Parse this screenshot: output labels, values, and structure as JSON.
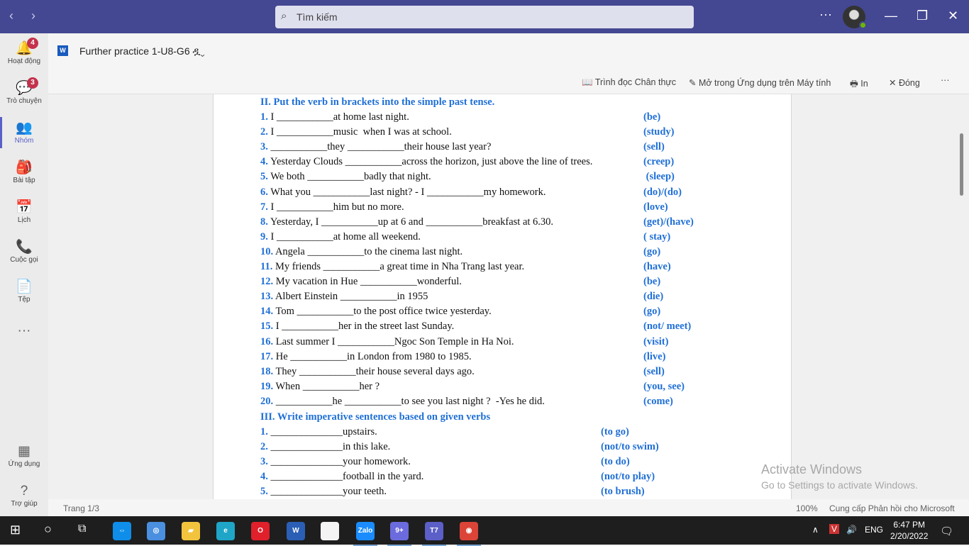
{
  "titlebar": {
    "search_placeholder": "Tìm kiếm",
    "more": "···"
  },
  "rail": [
    {
      "label": "Hoạt động",
      "icon": "bell-icon",
      "glyph": "🔔",
      "badge": "4"
    },
    {
      "label": "Trò chuyện",
      "icon": "chat-icon",
      "glyph": "💬",
      "badge": "3"
    },
    {
      "label": "Nhóm",
      "icon": "teams-icon",
      "glyph": "👥",
      "active": true
    },
    {
      "label": "Bài tập",
      "icon": "backpack-icon",
      "glyph": "🎒"
    },
    {
      "label": "Lịch",
      "icon": "calendar-icon",
      "glyph": "📅"
    },
    {
      "label": "Cuộc gọi",
      "icon": "phone-icon",
      "glyph": "📞"
    },
    {
      "label": "Tệp",
      "icon": "file-icon",
      "glyph": "📄"
    },
    {
      "label": "",
      "icon": "more-icon",
      "glyph": "···"
    },
    {
      "label": "Ứng dụng",
      "icon": "apps-icon",
      "glyph": "▦"
    },
    {
      "label": "Trợ giúp",
      "icon": "help-icon",
      "glyph": "?"
    }
  ],
  "header": {
    "doc_title": "Further practice 1-U8-G6"
  },
  "toolbar": {
    "immersive": "Trình đọc Chân thực",
    "open_desktop": "Mở trong Ứng dụng trên Máy tính",
    "print": "In",
    "close": "Đóng",
    "more": "···"
  },
  "document": {
    "section2": {
      "title": "II. Put the verb in brackets into the simple past tense.",
      "items": [
        {
          "n": "1.",
          "t": " I ___________at home last night.",
          "h": "(be)"
        },
        {
          "n": "2.",
          "t": " I ___________music  when I was at school.",
          "h": "(study)"
        },
        {
          "n": "3.",
          "t": " ___________they ___________their house last year?",
          "h": "(sell)"
        },
        {
          "n": "4.",
          "t": " Yesterday Clouds ___________across the horizon, just above the line of trees.",
          "h": "(creep)"
        },
        {
          "n": "5.",
          "t": " We both ___________badly that night.",
          "h": " (sleep)"
        },
        {
          "n": "6.",
          "t": " What you ___________last night? - I ___________my homework.",
          "h": "(do)/(do)"
        },
        {
          "n": "7.",
          "t": " I ___________him but no more.",
          "h": "(love)"
        },
        {
          "n": "8.",
          "t": " Yesterday, I ___________up at 6 and ___________breakfast at 6.30.",
          "h": "(get)/(have)"
        },
        {
          "n": "9.",
          "t": " I ___________at home all weekend.",
          "h": "( stay)"
        },
        {
          "n": "10.",
          "t": " Angela ___________to the cinema last night.",
          "h": "(go)"
        },
        {
          "n": "11.",
          "t": " My friends ___________a great time in Nha Trang last year.",
          "h": "(have)"
        },
        {
          "n": "12.",
          "t": " My vacation in Hue ___________wonderful.",
          "h": "(be)"
        },
        {
          "n": "13.",
          "t": " Albert Einstein ___________in 1955",
          "h": "(die)"
        },
        {
          "n": "14.",
          "t": " Tom ___________to the post office twice yesterday.",
          "h": "(go)"
        },
        {
          "n": "15.",
          "t": " I ___________her in the street last Sunday.",
          "h": "(not/ meet)"
        },
        {
          "n": "16.",
          "t": " Last summer I ___________Ngoc Son Temple in Ha Noi.",
          "h": "(visit)"
        },
        {
          "n": "17.",
          "t": " He ___________in London from 1980 to 1985.",
          "h": "(live)"
        },
        {
          "n": "18.",
          "t": " They ___________their house several days ago.",
          "h": "(sell)"
        },
        {
          "n": "19.",
          "t": " When ___________her ?",
          "h": "(you, see)"
        },
        {
          "n": "20.",
          "t": " ___________he ___________to see you last night ?  -Yes he did.",
          "h": "(come)"
        }
      ]
    },
    "section3": {
      "title": "III. Write imperative sentences based on given verbs",
      "items": [
        {
          "n": "1.",
          "t": " ______________upstairs.",
          "h": "(to go)"
        },
        {
          "n": "2.",
          "t": " ______________in this lake.",
          "h": "(not/to swim)"
        },
        {
          "n": "3.",
          "t": " ______________your homework.",
          "h": "(to do)"
        },
        {
          "n": "4.",
          "t": " ______________football in the yard.",
          "h": "(not/to play)"
        },
        {
          "n": "5.",
          "t": " ______________your teeth.",
          "h": "(to brush)"
        }
      ]
    }
  },
  "watermark": {
    "line1": "Activate Windows",
    "line2": "Go to Settings to activate Windows."
  },
  "status": {
    "page": "Trang 1/3",
    "zoom": "100%",
    "feedback": "Cung cấp Phản hồi cho Microsoft"
  },
  "taskbar": {
    "apps": [
      {
        "name": "teamviewer",
        "color": "#0e8ee9",
        "label": "⇔"
      },
      {
        "name": "cortana-chrome",
        "color": "#4a8fe0",
        "label": "◎"
      },
      {
        "name": "file-explorer",
        "color": "#f2c43d",
        "label": "▰"
      },
      {
        "name": "edge",
        "color": "#1fa5c7",
        "label": "e"
      },
      {
        "name": "opera",
        "color": "#e0202a",
        "label": "O"
      },
      {
        "name": "word",
        "color": "#2b5fb5",
        "label": "W"
      },
      {
        "name": "notepad",
        "color": "#f4f4f4",
        "label": ""
      },
      {
        "name": "zalo",
        "color": "#1a8cff",
        "label": "Zalo"
      },
      {
        "name": "messenger",
        "color": "#6b6bdd",
        "label": "9+"
      },
      {
        "name": "teams",
        "color": "#5b5fc7",
        "label": "T7"
      },
      {
        "name": "chrome",
        "color": "#db4437",
        "label": "◉"
      }
    ],
    "lang": "ENG",
    "time": "6:47 PM",
    "date": "2/20/2022"
  }
}
